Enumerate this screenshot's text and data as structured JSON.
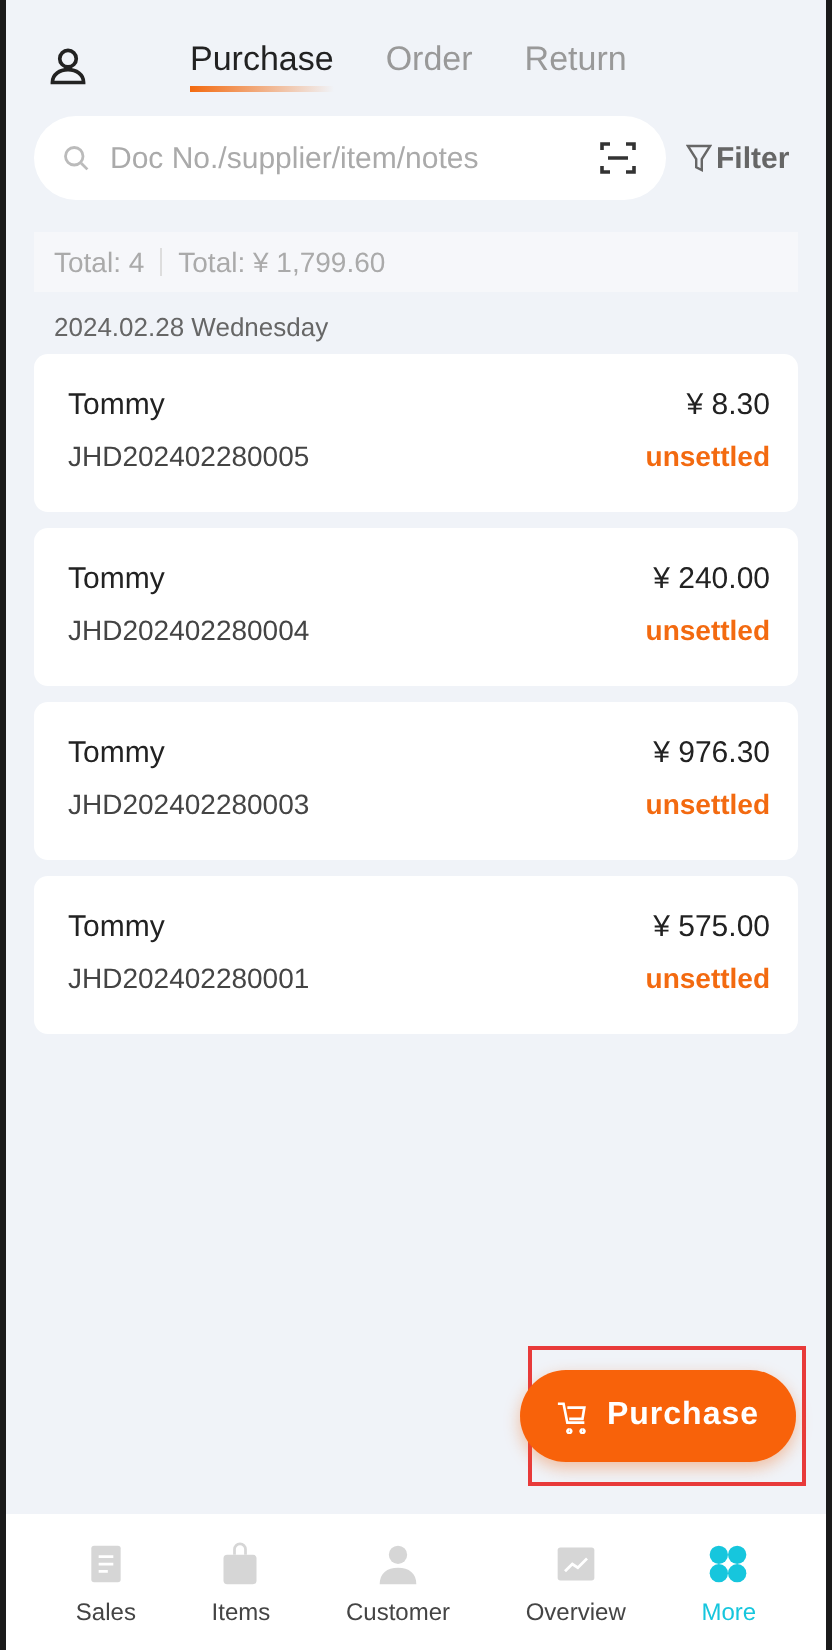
{
  "tabs": [
    {
      "label": "Purchase",
      "selected": true
    },
    {
      "label": "Order",
      "selected": false
    },
    {
      "label": "Return",
      "selected": false
    }
  ],
  "search": {
    "placeholder": "Doc No./supplier/item/notes"
  },
  "filter": {
    "label": "Filter"
  },
  "summary": {
    "count": "Total: 4",
    "amount": "Total: ¥ 1,799.60"
  },
  "date": "2024.02.28 Wednesday",
  "records": [
    {
      "name": "Tommy",
      "doc": "JHD202402280005",
      "amount": "¥ 8.30",
      "status": "unsettled"
    },
    {
      "name": "Tommy",
      "doc": "JHD202402280004",
      "amount": "¥ 240.00",
      "status": "unsettled"
    },
    {
      "name": "Tommy",
      "doc": "JHD202402280003",
      "amount": "¥ 976.30",
      "status": "unsettled"
    },
    {
      "name": "Tommy",
      "doc": "JHD202402280001",
      "amount": "¥ 575.00",
      "status": "unsettled"
    }
  ],
  "fab": {
    "label": "Purchase",
    "highlighted": true
  },
  "nav": [
    {
      "label": "Sales",
      "kind": "doc",
      "selected": false
    },
    {
      "label": "Items",
      "kind": "bag",
      "selected": false
    },
    {
      "label": "Customer",
      "kind": "person",
      "selected": false
    },
    {
      "label": "Overview",
      "kind": "chart",
      "selected": false
    },
    {
      "label": "More",
      "kind": "clover",
      "selected": true
    }
  ]
}
